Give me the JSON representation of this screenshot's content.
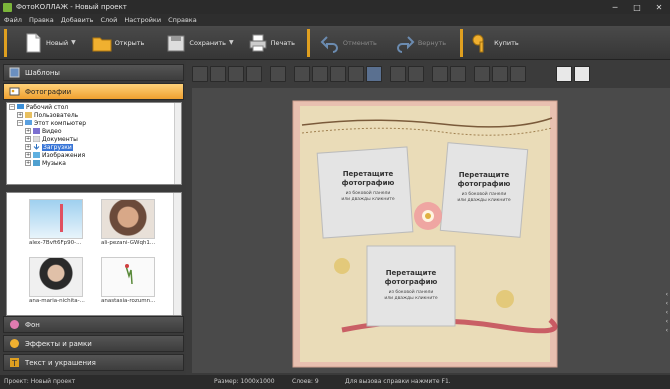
{
  "window": {
    "title": "ФотоКОЛЛАЖ - Новый проект"
  },
  "menu": [
    "Файл",
    "Правка",
    "Добавить",
    "Слой",
    "Настройки",
    "Справка"
  ],
  "toolbar": {
    "new_label": "Новый",
    "open_label": "Открыть",
    "save_label": "Сохранить",
    "print_label": "Печать",
    "undo_label": "Отменить",
    "redo_label": "Вернуть",
    "buy_label": "Купить"
  },
  "sidebar": {
    "templates_label": "Шаблоны",
    "photos_label": "Фотографии",
    "background_label": "Фон",
    "effects_label": "Эффекты и рамки",
    "text_label": "Текст и украшения"
  },
  "tree": {
    "items": [
      "Рабочий стол",
      "Пользователь",
      "Этот компьютер",
      "Видео",
      "Документы",
      "Загрузки",
      "Изображения",
      "Музыка"
    ]
  },
  "thumbnails": [
    {
      "caption": "alex-7Bvft6Fp90-..."
    },
    {
      "caption": "ali-pezani-GWqh1..."
    },
    {
      "caption": "ana-maria-nichita-..."
    },
    {
      "caption": "anastasia-rozumn..."
    }
  ],
  "canvas": {
    "placeholder_title": "Перетащите фотографию",
    "placeholder_sub": "из боковой панели или дважды кликните"
  },
  "status": {
    "project": "Проект:  Новый проект",
    "size": "Размер:   1000x1000",
    "layers": "Слоев:   9",
    "help": "Для вызова справки нажмите F1."
  },
  "colors": {
    "accent": "#f0a030",
    "selection": "#3875d7"
  }
}
